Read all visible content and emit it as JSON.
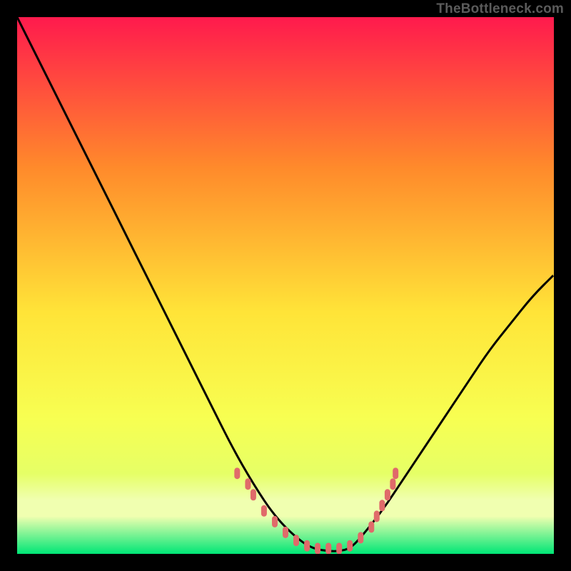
{
  "watermark": "TheBottleneck.com",
  "colors": {
    "frame_background": "#000000",
    "gradient_top": "#ff1a4d",
    "gradient_upper_mid": "#ff8a2b",
    "gradient_mid": "#ffe438",
    "gradient_lower_mid": "#f7ff52",
    "gradient_low": "#e6ff66",
    "gradient_band": "#f0ffb0",
    "gradient_bottom": "#00e676",
    "curve_stroke": "#000000",
    "marker_fill": "#e06a6a",
    "marker_inner": "#cd4a4a"
  },
  "chart_data": {
    "type": "line",
    "title": "",
    "xlabel": "",
    "ylabel": "",
    "xlim": [
      0,
      100
    ],
    "ylim": [
      0,
      100
    ],
    "series": [
      {
        "name": "bottleneck-curve",
        "x": [
          0,
          4,
          8,
          12,
          16,
          20,
          24,
          28,
          32,
          36,
          40,
          44,
          48,
          52,
          55,
          58,
          60,
          62,
          64,
          68,
          72,
          76,
          80,
          84,
          88,
          92,
          96,
          100
        ],
        "y": [
          100,
          92,
          84,
          76,
          68,
          60,
          52,
          44,
          36,
          28,
          20,
          13,
          7,
          3,
          1,
          0.5,
          0.5,
          1,
          3,
          8,
          14,
          20,
          26,
          32,
          38,
          43,
          48,
          52
        ]
      }
    ],
    "markers": [
      {
        "x": 41,
        "y": 15
      },
      {
        "x": 43,
        "y": 13
      },
      {
        "x": 44,
        "y": 11
      },
      {
        "x": 46,
        "y": 8
      },
      {
        "x": 48,
        "y": 6
      },
      {
        "x": 50,
        "y": 4
      },
      {
        "x": 52,
        "y": 2.5
      },
      {
        "x": 54,
        "y": 1.5
      },
      {
        "x": 56,
        "y": 1
      },
      {
        "x": 58,
        "y": 1
      },
      {
        "x": 60,
        "y": 1
      },
      {
        "x": 62,
        "y": 1.5
      },
      {
        "x": 64,
        "y": 3
      },
      {
        "x": 66,
        "y": 5
      },
      {
        "x": 67,
        "y": 7
      },
      {
        "x": 68,
        "y": 9
      },
      {
        "x": 69,
        "y": 11
      },
      {
        "x": 70,
        "y": 13
      },
      {
        "x": 70.5,
        "y": 15
      }
    ],
    "gradient_stops_pct": [
      0,
      28,
      55,
      75,
      85,
      90,
      93,
      100
    ]
  }
}
